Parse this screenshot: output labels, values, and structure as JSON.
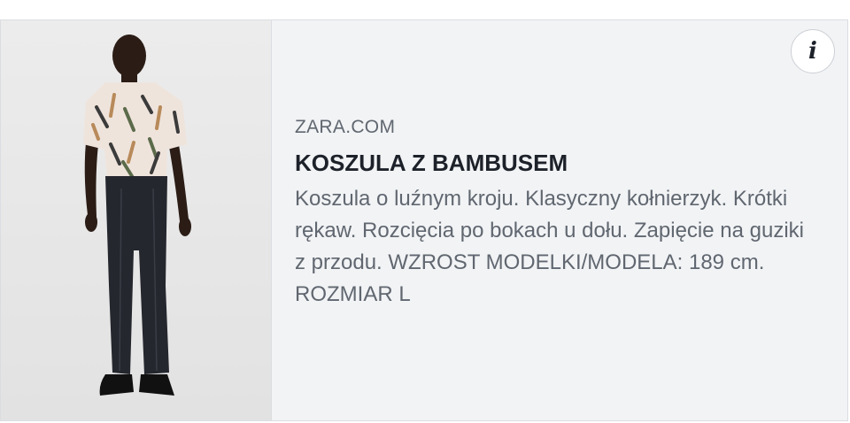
{
  "link_preview": {
    "domain": "ZARA.COM",
    "title": "KOSZULA Z BAMBUSEM",
    "description": "Koszula o luźnym kroju. Klasyczny kołnierzyk. Krótki rękaw. Rozcięcia po bokach u dołu. Zapięcie na guziki z przodu. WZROST MODELKI/MODELA: 189 cm. ROZMIAR L",
    "info_icon": "info-icon",
    "info_glyph": "i"
  },
  "colors": {
    "card_background": "#f2f3f5",
    "card_border": "#dadde1",
    "title_color": "#1d2129",
    "text_color": "#606770"
  }
}
